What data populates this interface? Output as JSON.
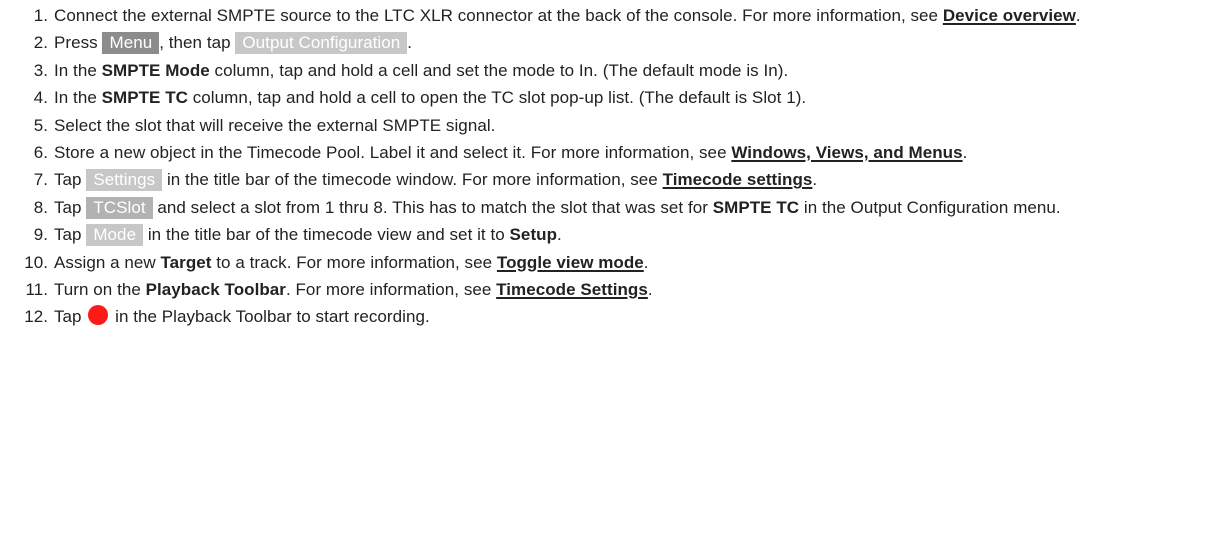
{
  "steps": [
    {
      "num": "1.",
      "t1": "Connect the external SMPTE source to the LTC XLR connector at the back of the console. For more information, see ",
      "link": "Device overview",
      "t2": "."
    },
    {
      "num": "2.",
      "t1": "Press ",
      "key1": "Menu",
      "t2": ", then tap ",
      "key2": "Output Configuration",
      "t3": "."
    },
    {
      "num": "3.",
      "t1": "In the ",
      "bold": "SMPTE Mode",
      "t2": " column, tap and hold a cell and set the mode to In. (The default mode is In)."
    },
    {
      "num": "4.",
      "t1": "In the ",
      "bold": "SMPTE TC",
      "t2": " column, tap and hold a cell to open the TC slot pop-up list. (The default is Slot 1)."
    },
    {
      "num": "5.",
      "t1": "Select the slot that will receive the external SMPTE signal."
    },
    {
      "num": "6.",
      "t1": "Store a new object in the Timecode Pool. Label it and select it. For more information, see ",
      "link": "Windows, Views, and Menus",
      "t2": "."
    },
    {
      "num": "7.",
      "t1": "Tap ",
      "key": "Settings",
      "t2": " in the title bar of the timecode window. For more information, see ",
      "link": "Timecode settings",
      "t3": "."
    },
    {
      "num": "8.",
      "t1": "Tap ",
      "key": "TCSlot",
      "t2": " and select a slot from 1 thru 8. This has to match the slot that was set for ",
      "bold": "SMPTE TC",
      "t3": " in the Output Configuration menu."
    },
    {
      "num": "9.",
      "t1": "Tap ",
      "key": "Mode",
      "t2": " in the title bar of the timecode view and set it to ",
      "bold": "Setup",
      "t3": "."
    },
    {
      "num": "10.",
      "t1": "Assign a new ",
      "bold": "Target",
      "t2": " to a track. For more information, see ",
      "link": "Toggle view mode",
      "t3": "."
    },
    {
      "num": "11.",
      "t1": "Turn on the ",
      "bold": "Playback Toolbar",
      "t2": ". For more information, see ",
      "link": "Timecode Settings",
      "t3": "."
    },
    {
      "num": "12.",
      "t1": "Tap ",
      "icon": "record-icon",
      "t2": " in the Playback Toolbar to start recording."
    }
  ],
  "colors": {
    "text": "#222222",
    "key_dark": "#8c8c8c",
    "key_light": "#b2b2b2",
    "key_lighter": "#c7c7c7",
    "record": "#ff1a1a"
  }
}
